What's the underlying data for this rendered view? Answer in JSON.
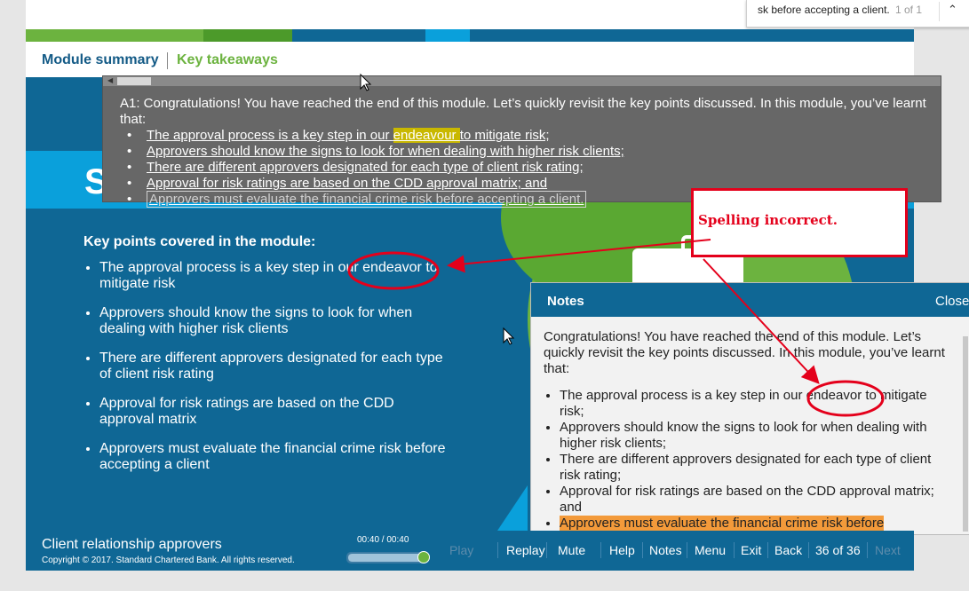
{
  "find_bar": {
    "query": "sk before accepting a client.",
    "count": "1 of 1",
    "up_icon": "chevron-up-icon"
  },
  "colors": {
    "primary": "#0f6795",
    "accent_green": "#6cb33f",
    "accent_blue": "#0aa0db",
    "annotation_red": "#e4001b",
    "highlight_yellow": "#c9b800",
    "highlight_orange": "#f39a3a"
  },
  "color_strip": [
    "#6cb33f",
    "#4c9a2a",
    "#0f6795",
    "#0aa0db",
    "#0f6795"
  ],
  "header": {
    "tab_summary": "Module summary",
    "tab_takeaways": "Key takeaways"
  },
  "slide": {
    "title_letter": "S",
    "key_heading": "Key points covered in the module:",
    "points": [
      "The approval process is a key step in our endeavor to mitigate risk",
      "Approvers should know the signs to look for when dealing with higher risk clients",
      "There are different approvers designated for each type of client risk rating",
      "Approval for risk ratings are based on the CDD approval matrix",
      "Approvers must evaluate the financial crime risk before accepting a client"
    ]
  },
  "transcript": {
    "intro": "A1: Congratulations! You have reached the end of this module. Let’s quickly revisit the key points discussed. In this module, you’ve learnt that:",
    "p1_before": "The approval process is a key step in our ",
    "p1_highlight": "endeavour ",
    "p1_after": "to mitigate risk;",
    "p2": "Approvers should know the signs to look for when dealing with higher risk clients;",
    "p3": "There are different approvers designated for each type of client risk rating;",
    "p4": "Approval for risk ratings are based on the CDD approval matrix; and",
    "p5": "Approvers must evaluate the financial crime risk before accepting a client."
  },
  "callout": {
    "text": "Spelling incorrect."
  },
  "notes": {
    "title": "Notes",
    "close": "Close",
    "intro": "Congratulations! You have reached the end of this module. Let’s quickly revisit the key points discussed. In this module, you’ve learnt that:",
    "p1": "The approval process is a key step in our endeavor to mitigate risk;",
    "p2": "Approvers should know the signs to look for when dealing with higher risk clients;",
    "p3": "There are different approvers designated for each type of client risk rating;",
    "p4": "Approval for risk ratings are based on the CDD approval matrix; and",
    "p5": "Approvers must evaluate the financial crime risk before"
  },
  "footer": {
    "course_title": "Client relationship approvers",
    "copyright": "Copyright © 2017. Standard Chartered Bank. All rights reserved.",
    "time": "00:40 / 00:40",
    "progress": 1.0,
    "play": "Play",
    "replay": "Replay",
    "mute": "Mute",
    "help": "Help",
    "notes": "Notes",
    "menu": "Menu",
    "exit": "Exit",
    "back": "Back",
    "page": "36 of 36",
    "next": "Next"
  }
}
